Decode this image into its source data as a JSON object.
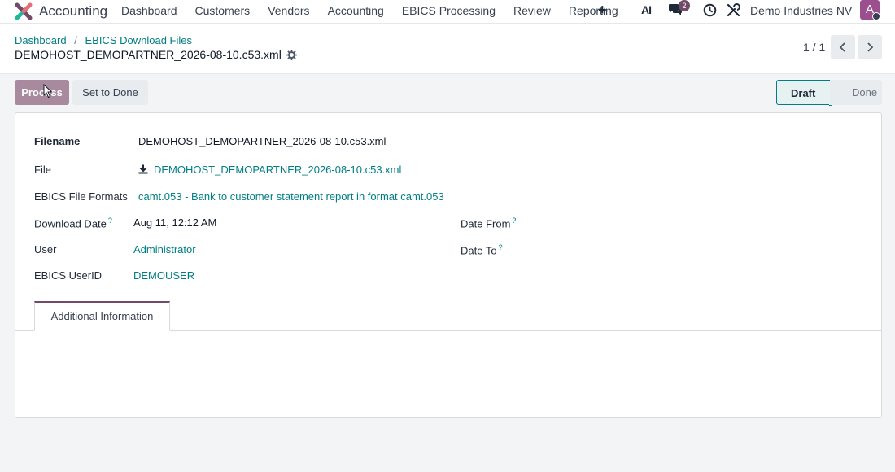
{
  "navbar": {
    "app_name": "Accounting",
    "menu": [
      "Dashboard",
      "Customers",
      "Vendors",
      "Accounting",
      "EBICS Processing",
      "Review",
      "Reporting"
    ],
    "ai_label": "AI",
    "chat_badge": "2",
    "company": "Demo Industries NV",
    "avatar_letter": "A",
    "brand_color": "#714b67"
  },
  "breadcrumb": {
    "items": [
      "Dashboard",
      "EBICS Download Files"
    ],
    "separator": "/",
    "current": "DEMOHOST_DEMOPARTNER_2026-08-10.c53.xml"
  },
  "pager": {
    "value": "1 / 1"
  },
  "actions": {
    "process": "Process",
    "set_to_done": "Set to Done"
  },
  "status": {
    "stages": [
      "Draft",
      "Done"
    ],
    "current": "Draft"
  },
  "form": {
    "filename_label": "Filename",
    "filename_value": "DEMOHOST_DEMOPARTNER_2026-08-10.c53.xml",
    "file_label": "File",
    "file_value": "DEMOHOST_DEMOPARTNER_2026-08-10.c53.xml",
    "formats_label": "EBICS File Formats",
    "formats_value": "camt.053 - Bank to customer statement report in format camt.053",
    "download_date_label": "Download Date",
    "download_date_value": "Aug 11, 12:12 AM",
    "user_label": "User",
    "user_value": "Administrator",
    "userid_label": "EBICS UserID",
    "userid_value": "DEMOUSER",
    "date_from_label": "Date From",
    "date_to_label": "Date To",
    "help_mark": "?"
  },
  "tabs": [
    "Additional Information"
  ]
}
